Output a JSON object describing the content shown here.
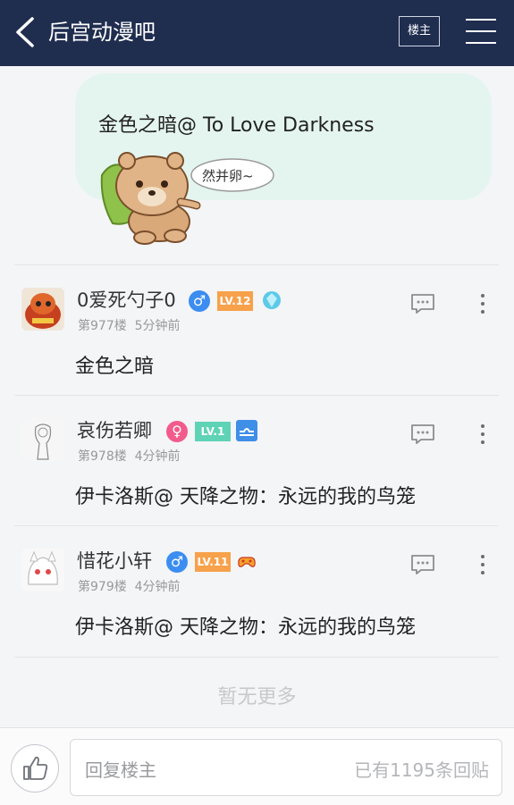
{
  "header": {
    "title": "后宫动漫吧",
    "louzhu_label": "楼主"
  },
  "top_post": {
    "content": "金色之暗@ To Love Darkness",
    "sticker_text": "然并卵~"
  },
  "posts": [
    {
      "username": "0爱死勺子0",
      "gender": "♂",
      "gender_color": "#3b8df1",
      "level": "LV.12",
      "level_color": "#f7a14b",
      "floor": "第977楼",
      "time": "5分钟前",
      "content": "金色之暗"
    },
    {
      "username": "哀伤若卿",
      "gender": "♀",
      "gender_color": "#f25b8b",
      "level": "LV.1",
      "level_color": "#5fd3b6",
      "floor": "第978楼",
      "time": "4分钟前",
      "content": "伊卡洛斯@ 天降之物：永远的我的鸟笼"
    },
    {
      "username": "惜花小轩",
      "gender": "♂",
      "gender_color": "#3b8df1",
      "level": "LV.11",
      "level_color": "#f7a14b",
      "floor": "第979楼",
      "time": "4分钟前",
      "content": "伊卡洛斯@ 天降之物：永远的我的鸟笼"
    }
  ],
  "no_more": "暂无更多",
  "bottom": {
    "reply_placeholder": "回复楼主",
    "reply_count": "已有1195条回贴"
  },
  "colors": {
    "header_bg": "#1f2d4f",
    "bubble_bg": "#e4f5ef"
  }
}
